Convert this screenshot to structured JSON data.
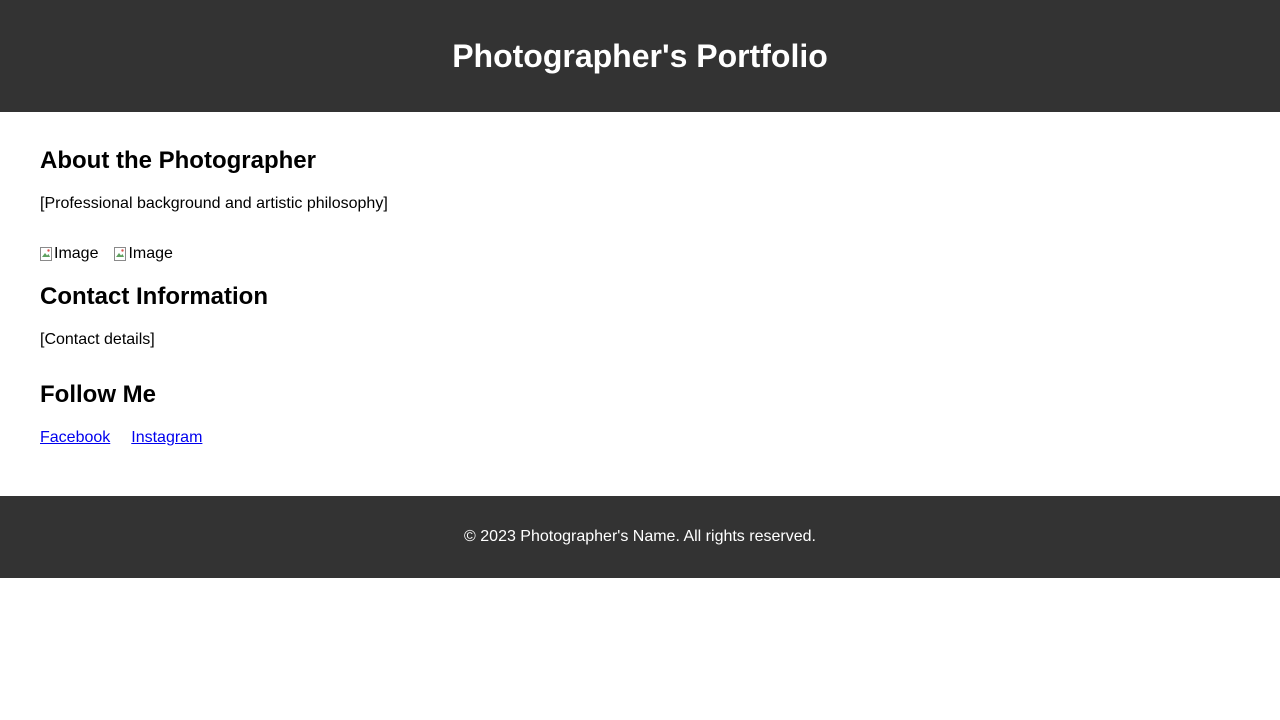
{
  "header": {
    "title": "Photographer's Portfolio"
  },
  "about": {
    "heading": "About the Photographer",
    "text": "[Professional background and artistic philosophy]"
  },
  "gallery": {
    "images": [
      {
        "alt": "Image"
      },
      {
        "alt": "Image"
      }
    ]
  },
  "contact": {
    "heading": "Contact Information",
    "text": "[Contact details]"
  },
  "social": {
    "heading": "Follow Me",
    "links": [
      {
        "label": "Facebook"
      },
      {
        "label": "Instagram"
      }
    ]
  },
  "footer": {
    "text": "© 2023 Photographer's Name. All rights reserved."
  },
  "colors": {
    "header_bg": "#333333",
    "footer_bg": "#333333",
    "link": "#0000ee",
    "text_on_dark": "#ffffff"
  }
}
